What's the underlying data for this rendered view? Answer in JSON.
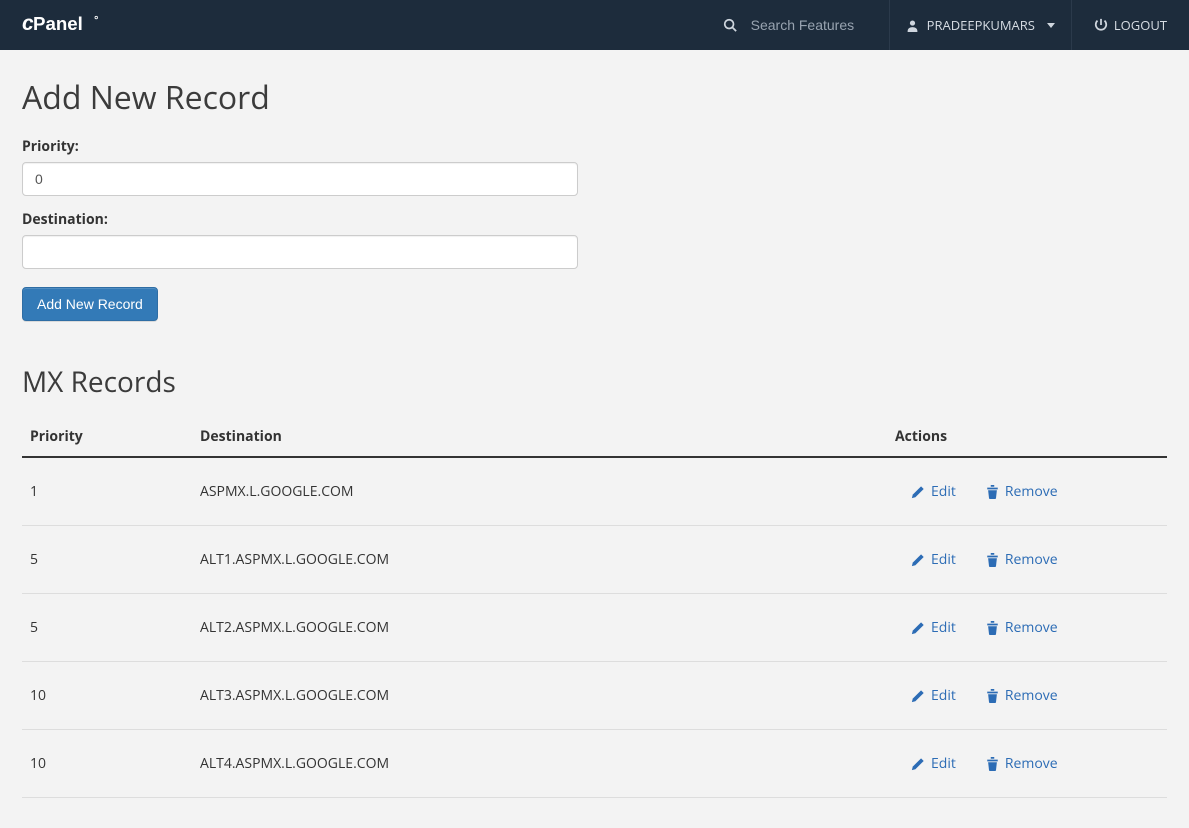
{
  "header": {
    "search_placeholder": "Search Features",
    "username": "PRADEEPKUMARS",
    "logout_label": "LOGOUT"
  },
  "form": {
    "title": "Add New Record",
    "priority_label": "Priority:",
    "priority_value": "0",
    "destination_label": "Destination:",
    "destination_value": "",
    "submit_label": "Add New Record"
  },
  "table": {
    "title": "MX Records",
    "columns": {
      "priority": "Priority",
      "destination": "Destination",
      "actions": "Actions"
    },
    "action_labels": {
      "edit": "Edit",
      "remove": "Remove"
    },
    "rows": [
      {
        "priority": "1",
        "destination": "ASPMX.L.GOOGLE.COM"
      },
      {
        "priority": "5",
        "destination": "ALT1.ASPMX.L.GOOGLE.COM"
      },
      {
        "priority": "5",
        "destination": "ALT2.ASPMX.L.GOOGLE.COM"
      },
      {
        "priority": "10",
        "destination": "ALT3.ASPMX.L.GOOGLE.COM"
      },
      {
        "priority": "10",
        "destination": "ALT4.ASPMX.L.GOOGLE.COM"
      }
    ]
  }
}
